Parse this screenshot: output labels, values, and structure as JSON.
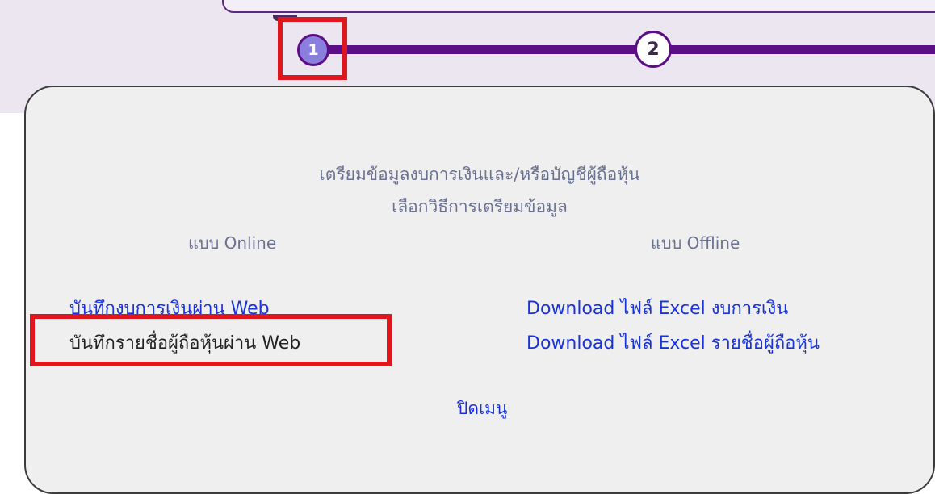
{
  "steps": [
    "1",
    "2"
  ],
  "dialog": {
    "subtitle": "เตรียมข้อมูลงบการเงินและ/หรือบัญชีผู้ถือหุ้น",
    "prompt": "เลือกวิธีการเตรียมข้อมูล",
    "online_heading": "แบบ Online",
    "offline_heading": "แบบ Offline",
    "online_links": [
      "บันทึกงบการเงินผ่าน Web",
      "บันทึกรายชื่อผู้ถือหุ้นผ่าน Web"
    ],
    "offline_links": [
      "Download ไฟล์ Excel งบการเงิน",
      "Download ไฟล์ Excel รายชื่อผู้ถือหุ้น"
    ],
    "close_label": "ปิดเมนู"
  },
  "colors": {
    "accent": "#5b0e86",
    "link": "#1a33d6",
    "highlight": "#e0161f",
    "muted_text": "#6a7292"
  }
}
